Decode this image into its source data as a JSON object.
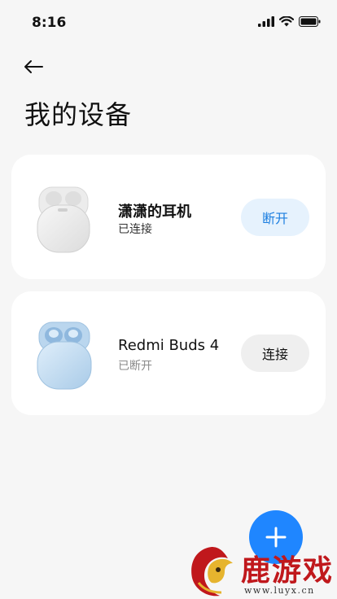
{
  "status_bar": {
    "time": "8:16",
    "icons": [
      "signal-icon",
      "wifi-icon",
      "battery-icon"
    ]
  },
  "header": {
    "back_icon": "back-arrow-icon",
    "title": "我的设备"
  },
  "devices": [
    {
      "name": "潇潇的耳机",
      "status": "已连接",
      "action_label": "断开",
      "image": "earbuds-case-white-image"
    },
    {
      "name": "Redmi Buds 4",
      "status": "已断开",
      "action_label": "连接",
      "image": "earbuds-case-blue-image"
    }
  ],
  "fab": {
    "icon": "plus-icon"
  },
  "watermark": {
    "logo": "deer-logo",
    "title": "鹿游戏",
    "url": "www.luyx.cn"
  },
  "colors": {
    "accent": "#1f86ff",
    "connected_button_bg": "#e6f2fd",
    "connected_button_text": "#1d7fe0",
    "disconnected_button_bg": "#efefef",
    "watermark_red": "#c0181c"
  }
}
